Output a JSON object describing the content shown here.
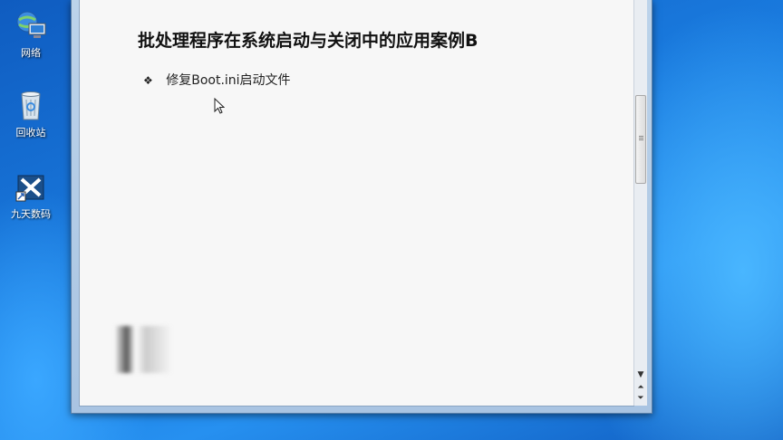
{
  "desktop": {
    "icons": [
      {
        "label": "网络"
      },
      {
        "label": "回收站"
      },
      {
        "label": "九天数码"
      }
    ]
  },
  "slide": {
    "title": "批处理程序在系统启动与关闭中的应用案例B",
    "bullets": [
      {
        "marker": "❖",
        "text": "修复Boot.ini启动文件"
      }
    ]
  },
  "scrollbar": {
    "down": "▼",
    "page_up": "⏶",
    "page_down": "⏷"
  }
}
